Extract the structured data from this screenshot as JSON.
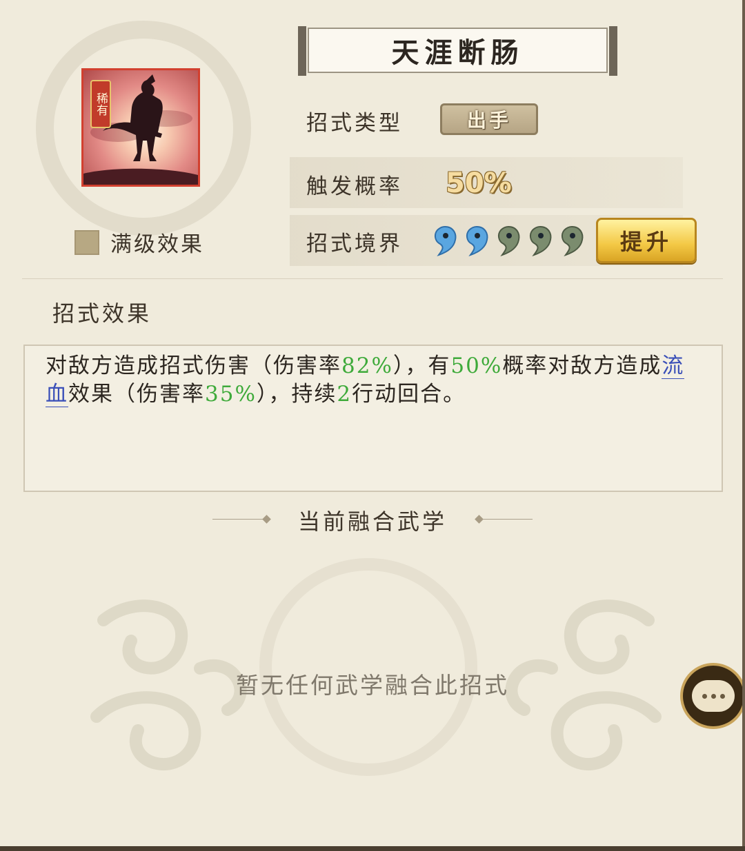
{
  "skill": {
    "name": "天涯断肠",
    "rarity": "稀有",
    "max_level_label": "满级效果",
    "max_level_checked": false
  },
  "stats": {
    "type_label": "招式类型",
    "type_value": "出手",
    "trigger_label": "触发概率",
    "trigger_value": "50%",
    "realm_label": "招式境界",
    "realm_filled": 2,
    "realm_total": 5,
    "upgrade_label": "提升"
  },
  "effect": {
    "section_title": "招式效果",
    "text_parts": {
      "p1": "对敌方造成招式伤害（伤害率",
      "v1": "82%",
      "p2": "），有",
      "v2": "50%",
      "p3": "概率对敌方造成",
      "link": "流血",
      "p4": "效果（伤害率",
      "v3": "35%",
      "p5": "），持续",
      "v4": "2",
      "p6": "行动回合。"
    }
  },
  "fusion": {
    "title": "当前融合武学",
    "empty_text": "暂无任何武学融合此招式"
  },
  "colors": {
    "highlight_green": "#3eaa3a",
    "link_blue": "#3a4fb8",
    "realm_active": "#5aa6e0",
    "realm_inactive": "#7b8c6e"
  },
  "icons": {
    "chat": "chat-bubble-icon"
  }
}
